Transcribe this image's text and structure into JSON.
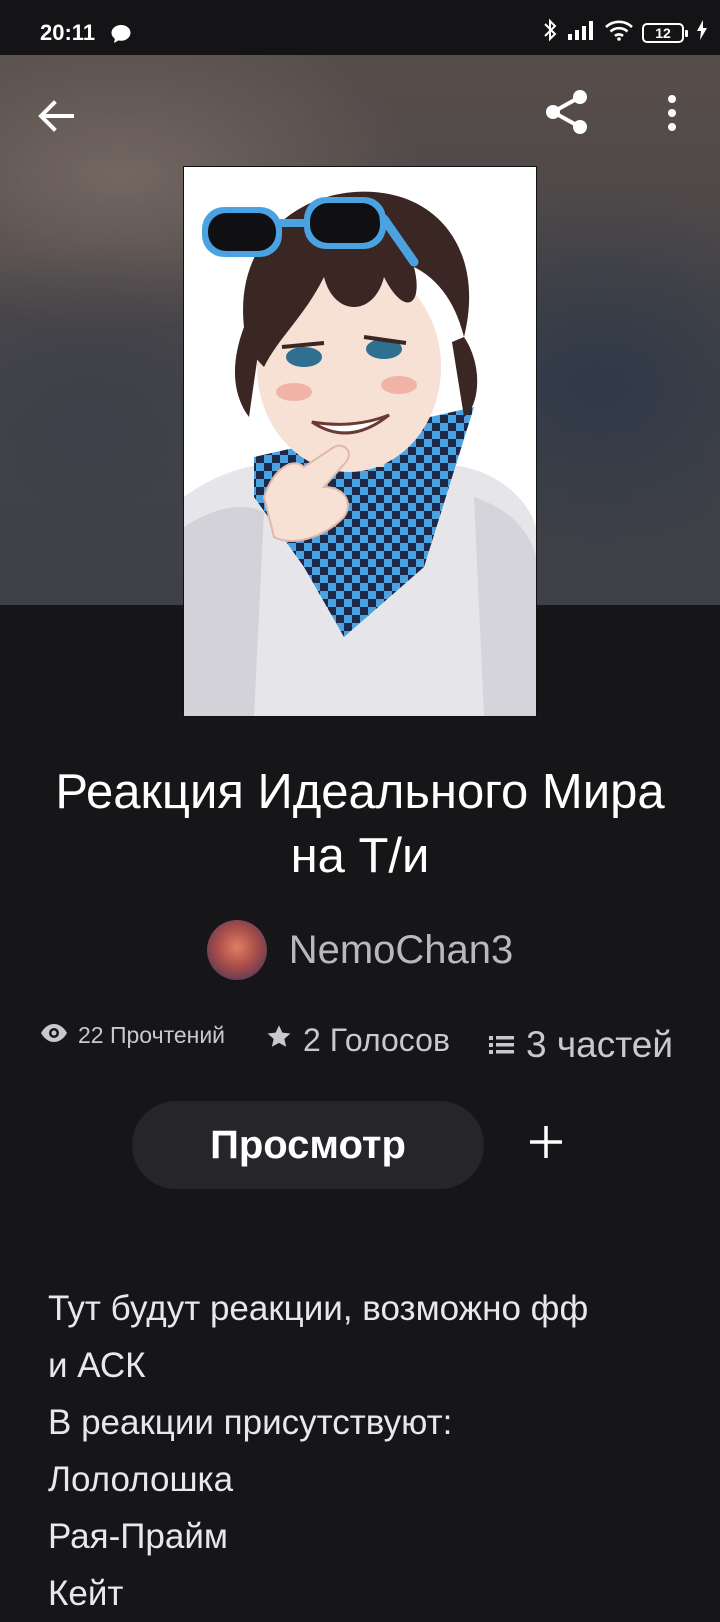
{
  "status_bar": {
    "time": "20:11",
    "battery": "12",
    "icons": [
      "chat-bubble-icon",
      "bluetooth-icon",
      "signal-icon",
      "wifi-icon",
      "battery-icon",
      "charging-icon"
    ]
  },
  "toolbar": {
    "icons": [
      "back-arrow-icon",
      "share-icon",
      "more-vertical-icon"
    ]
  },
  "story": {
    "title": "Реакция Идеального Мира на Т/и",
    "author": "NemoChan3",
    "reads": "22 Прочтений",
    "votes": "2 Голосов",
    "parts": "3 частей",
    "read_button": "Просмотр",
    "description_lines": [
      "Тут будут реакции, возможно фф",
      "и АСК",
      "В реакции присутствуют:",
      "Лололошка",
      "Рая-Прайм",
      "Кейт"
    ]
  },
  "colors": {
    "background": "#161518",
    "button_bg": "#26252a",
    "muted_text": "#b9b8bc",
    "cover_accent_blue": "#4aa3e0"
  }
}
